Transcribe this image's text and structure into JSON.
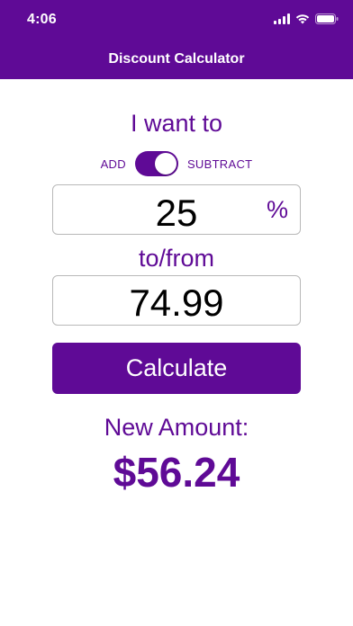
{
  "status_bar": {
    "time": "4:06"
  },
  "nav": {
    "title": "Discount Calculator"
  },
  "prompt": {
    "i_want": "I want to"
  },
  "toggle": {
    "left_label": "ADD",
    "right_label": "SUBTRACT",
    "selected": "SUBTRACT"
  },
  "percent_field": {
    "value": "25",
    "unit": "%"
  },
  "to_from": {
    "label": "to/from"
  },
  "amount_field": {
    "value": "74.99"
  },
  "calculate_button": {
    "label": "Calculate"
  },
  "result": {
    "label": "New Amount:",
    "value": "$56.24"
  },
  "colors": {
    "brand": "#5f0a96",
    "background": "#ffffff",
    "field_border": "#b8b8b8"
  }
}
